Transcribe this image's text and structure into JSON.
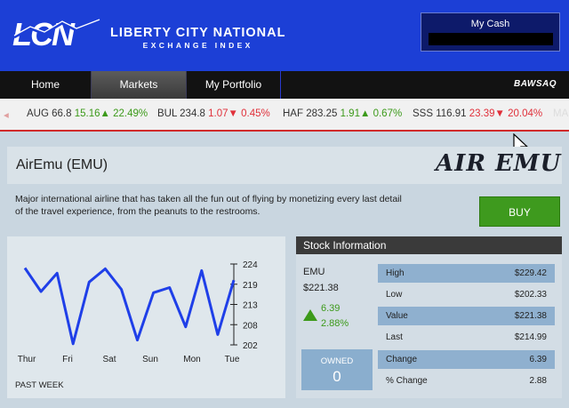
{
  "header": {
    "brand_line1": "LIBERTY CITY NATIONAL",
    "brand_line2": "EXCHANGE INDEX",
    "cash_label": "My Cash"
  },
  "nav": {
    "items": [
      "Home",
      "Markets",
      "My Portfolio"
    ],
    "active": "Markets",
    "partner": "BAWSAQ"
  },
  "ticker": [
    {
      "symbol": "AUG",
      "price": "66.8",
      "change": "15.16",
      "pct": "22.49%",
      "direction": "up"
    },
    {
      "symbol": "BUL",
      "price": "234.8",
      "change": "1.07",
      "pct": "0.45%",
      "direction": "down"
    },
    {
      "symbol": "HAF",
      "price": "283.25",
      "change": "1.91",
      "pct": "0.67%",
      "direction": "up"
    },
    {
      "symbol": "SSS",
      "price": "116.91",
      "change": "23.39",
      "pct": "20.04%",
      "direction": "down"
    },
    {
      "symbol": "MA",
      "price": "",
      "change": "",
      "pct": "",
      "direction": "none"
    }
  ],
  "company": {
    "name": "AirEmu (EMU)",
    "logo_text": "AIR EMU",
    "description": "Major international airline that has taken all the fun out of flying by monetizing every last detail of the travel experience, from the peanuts to the restrooms.",
    "buy_label": "BUY"
  },
  "chart_data": {
    "type": "line",
    "x": [
      "Thur",
      "Fri",
      "Sat",
      "Sun",
      "Mon",
      "Tue"
    ],
    "y_ticks": [
      "224",
      "219",
      "213",
      "208",
      "202"
    ],
    "ylim": [
      202,
      224
    ],
    "series": [
      {
        "values": [
          222.9,
          216.5,
          221.5,
          202.3,
          219.1,
          222.7,
          217.1,
          203.3,
          216.2,
          217.6,
          206.9,
          222.2,
          204.8,
          219.6
        ],
        "color": "#1f3fe8"
      }
    ],
    "footer_label": "PAST WEEK"
  },
  "stock": {
    "title": "Stock Information",
    "symbol": "EMU",
    "price": "$221.38",
    "change_abs": "6.39",
    "change_pct": "2.88%",
    "owned_label": "OWNED",
    "owned_value": "0",
    "rows": [
      {
        "label": "High",
        "value": "$229.42"
      },
      {
        "label": "Low",
        "value": "$202.33"
      },
      {
        "label": "Value",
        "value": "$221.38"
      },
      {
        "label": "Last",
        "value": "$214.99"
      },
      {
        "label": "Change",
        "value": "6.39"
      },
      {
        "label": "% Change",
        "value": "2.88"
      }
    ]
  },
  "colors": {
    "header_blue": "#1c3fd6",
    "buy_green": "#3e9a1e",
    "up_green": "#3c9a1a",
    "down_red": "#e0303a",
    "line_blue": "#1f3fe8"
  }
}
